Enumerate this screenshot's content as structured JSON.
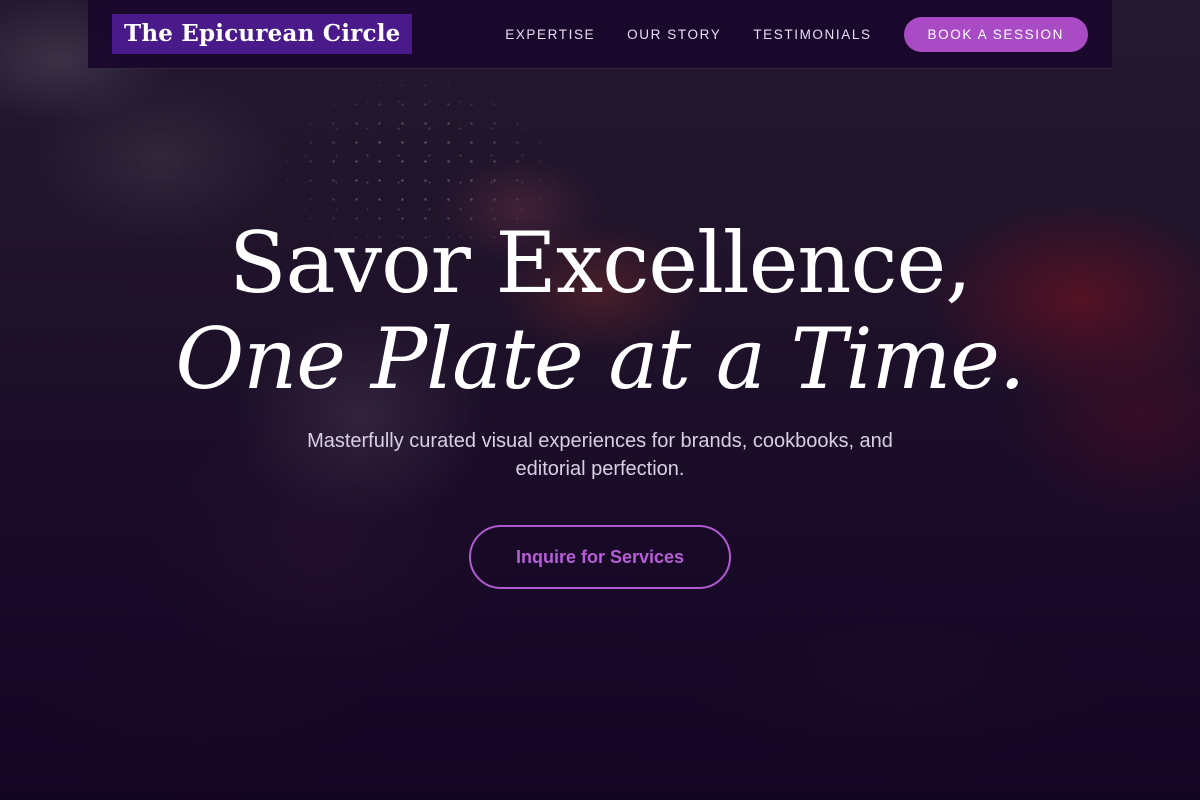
{
  "brand": {
    "name": "The Epicurean Circle"
  },
  "nav": {
    "items": [
      {
        "label": "EXPERTISE"
      },
      {
        "label": "OUR STORY"
      },
      {
        "label": "TESTIMONIALS"
      }
    ],
    "cta_label": "BOOK A SESSION"
  },
  "hero": {
    "headline_line1": "Savor Excellence,",
    "headline_line2": "One Plate at a Time.",
    "subtext": "Masterfully curated visual experiences for brands, cookbooks, and editorial perfection.",
    "cta_label": "Inquire for Services"
  },
  "colors": {
    "brand_bg": "#4a1a8a",
    "accent": "#a94bc4",
    "overlay": "#1a0a2e"
  }
}
